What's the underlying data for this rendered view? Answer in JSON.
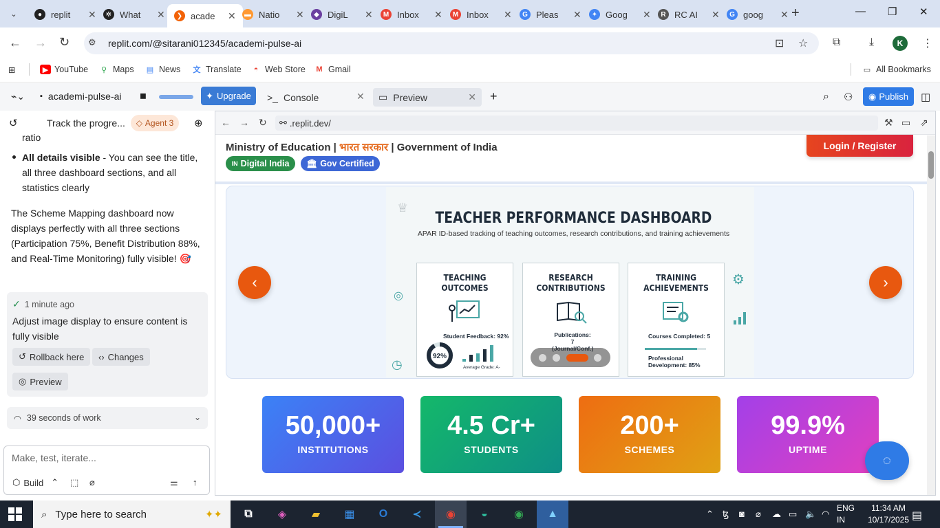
{
  "browser": {
    "tabs": [
      {
        "title": "replit",
        "icon": "github-icon",
        "color": "#222222"
      },
      {
        "title": "What",
        "icon": "chatgpt-icon",
        "color": "#222222"
      },
      {
        "title": "acade",
        "icon": "replit-icon",
        "color": "#f26207",
        "active": true
      },
      {
        "title": "Natio",
        "icon": "india-flag-icon",
        "color": "#ff9933"
      },
      {
        "title": "DigiL",
        "icon": "digilocker-icon",
        "color": "#6b3fa0"
      },
      {
        "title": "Inbox",
        "icon": "gmail-icon",
        "color": "#ea4335"
      },
      {
        "title": "Inbox",
        "icon": "gmail-icon",
        "color": "#ea4335"
      },
      {
        "title": "Pleas",
        "icon": "google-icon",
        "color": "#4285f4"
      },
      {
        "title": "Goog",
        "icon": "gemini-icon",
        "color": "#4285f4"
      },
      {
        "title": "RC AI",
        "icon": "rc-icon",
        "color": "#555555"
      },
      {
        "title": "goog",
        "icon": "google-icon",
        "color": "#4285f4"
      }
    ],
    "url": "replit.com/@sitarani012345/academi-pulse-ai",
    "profile_initial": "K",
    "bookmarks": [
      {
        "label": "YouTube",
        "icon": "youtube-icon"
      },
      {
        "label": "Maps",
        "icon": "maps-icon"
      },
      {
        "label": "News",
        "icon": "news-icon"
      },
      {
        "label": "Translate",
        "icon": "translate-icon"
      },
      {
        "label": "Web Store",
        "icon": "webstore-icon"
      },
      {
        "label": "Gmail",
        "icon": "gmail-icon"
      }
    ],
    "all_bookmarks": "All Bookmarks"
  },
  "workspace": {
    "project_name": "academi-pulse-ai",
    "upgrade_label": "Upgrade",
    "tabs": [
      {
        "label": "Console",
        "prefix": ">_"
      },
      {
        "label": "Preview",
        "prefix": "▭",
        "active": true
      }
    ],
    "publish_label": "Publish"
  },
  "agent": {
    "title": "Track the progre...",
    "badge": "Agent 3",
    "partial_line": "ratio",
    "bullet_bold": "All details visible",
    "bullet_text": " - You can see the title, all three dashboard sections, and all statistics clearly",
    "summary": "The Scheme Mapping dashboard now displays perfectly with all three sections (Participation 75%, Benefit Distribution 88%, and Real-Time Monitoring) fully visible! 🎯",
    "checkpoint": {
      "time": "1 minute ago",
      "message": "Adjust image display to ensure content is fully visible",
      "rollback": "Rollback here",
      "changes": "Changes",
      "preview": "Preview"
    },
    "work_time": "39 seconds of work",
    "input_placeholder": "Make, test, iterate...",
    "build_label": "Build"
  },
  "preview": {
    "url": ".replit.dev/",
    "header_prefix": "Ministry of Education | ",
    "header_hindi": "भारत सरकार",
    "header_suffix": " | Government of India",
    "digital_india": "Digital India",
    "digital_india_flag": "IN",
    "gov_certified": "Gov Certified",
    "login": "Login / Register",
    "slide": {
      "title": "TEACHER PERFORMANCE DASHBOARD",
      "subtitle": "APAR ID-based tracking of teaching outcomes, research contributions, and training achievements",
      "cards": [
        {
          "title": "TEACHING OUTCOMES",
          "line1": "Student Feedback: 92%",
          "donut": "92%",
          "line2": "Average Grade: A-"
        },
        {
          "title": "RESEARCH CONTRIBUTIONS",
          "line1": "Publications: 7",
          "line2": "(Journal/Conf.)"
        },
        {
          "title": "TRAINING ACHIEVEMENTS",
          "line1": "Courses Completed: 5",
          "line2": "Professional",
          "line3": "Development: 85%"
        }
      ]
    },
    "stats": [
      {
        "value": "50,000+",
        "label": "INSTITUTIONS"
      },
      {
        "value": "4.5 Cr+",
        "label": "STUDENTS"
      },
      {
        "value": "200+",
        "label": "SCHEMES"
      },
      {
        "value": "99.9%",
        "label": "UPTIME"
      }
    ]
  },
  "taskbar": {
    "search_placeholder": "Type here to search",
    "lang_line1": "ENG",
    "lang_line2": "IN",
    "time": "11:34 AM",
    "date": "10/17/2025"
  }
}
